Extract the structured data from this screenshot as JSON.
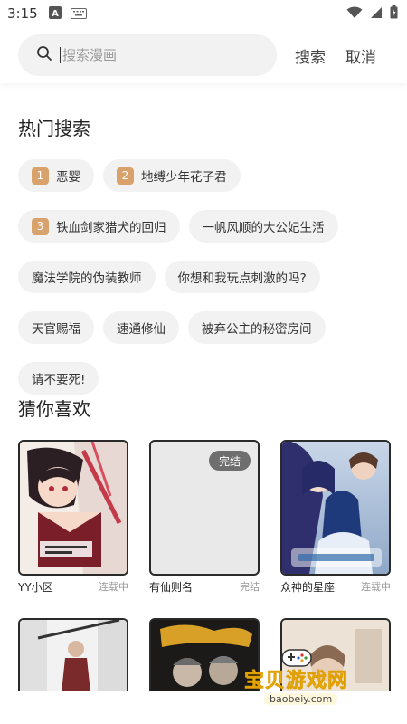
{
  "status_bar": {
    "time": "3:15"
  },
  "search": {
    "placeholder": "搜索漫画",
    "search_label": "搜索",
    "cancel_label": "取消"
  },
  "hot": {
    "title": "热门搜索",
    "items": [
      {
        "rank": "1",
        "label": "恶婴"
      },
      {
        "rank": "2",
        "label": "地缚少年花子君"
      },
      {
        "rank": "3",
        "label": "铁血剑家猎犬的回归"
      },
      {
        "label": "一帆风顺的大公妃生活"
      },
      {
        "label": "魔法学院的伪装教师"
      },
      {
        "label": "你想和我玩点刺激的吗?"
      },
      {
        "label": "天官赐福"
      },
      {
        "label": "速通修仙"
      },
      {
        "label": "被弃公主的秘密房间"
      },
      {
        "label": "请不要死!"
      }
    ]
  },
  "guess": {
    "title": "猜你喜欢",
    "cards": [
      {
        "title": "YY小区",
        "status": "连载中"
      },
      {
        "title": "有仙则名",
        "status": "完结",
        "badge": "完结"
      },
      {
        "title": "众神的星座",
        "status": "连载中"
      }
    ]
  },
  "watermark": {
    "text": "宝贝游戏网",
    "url": "baobeiy.com"
  },
  "colors": {
    "rank_badge": "#d9a16b",
    "tag_bg": "#f2f2f2",
    "search_bg": "#f2f2f2"
  }
}
